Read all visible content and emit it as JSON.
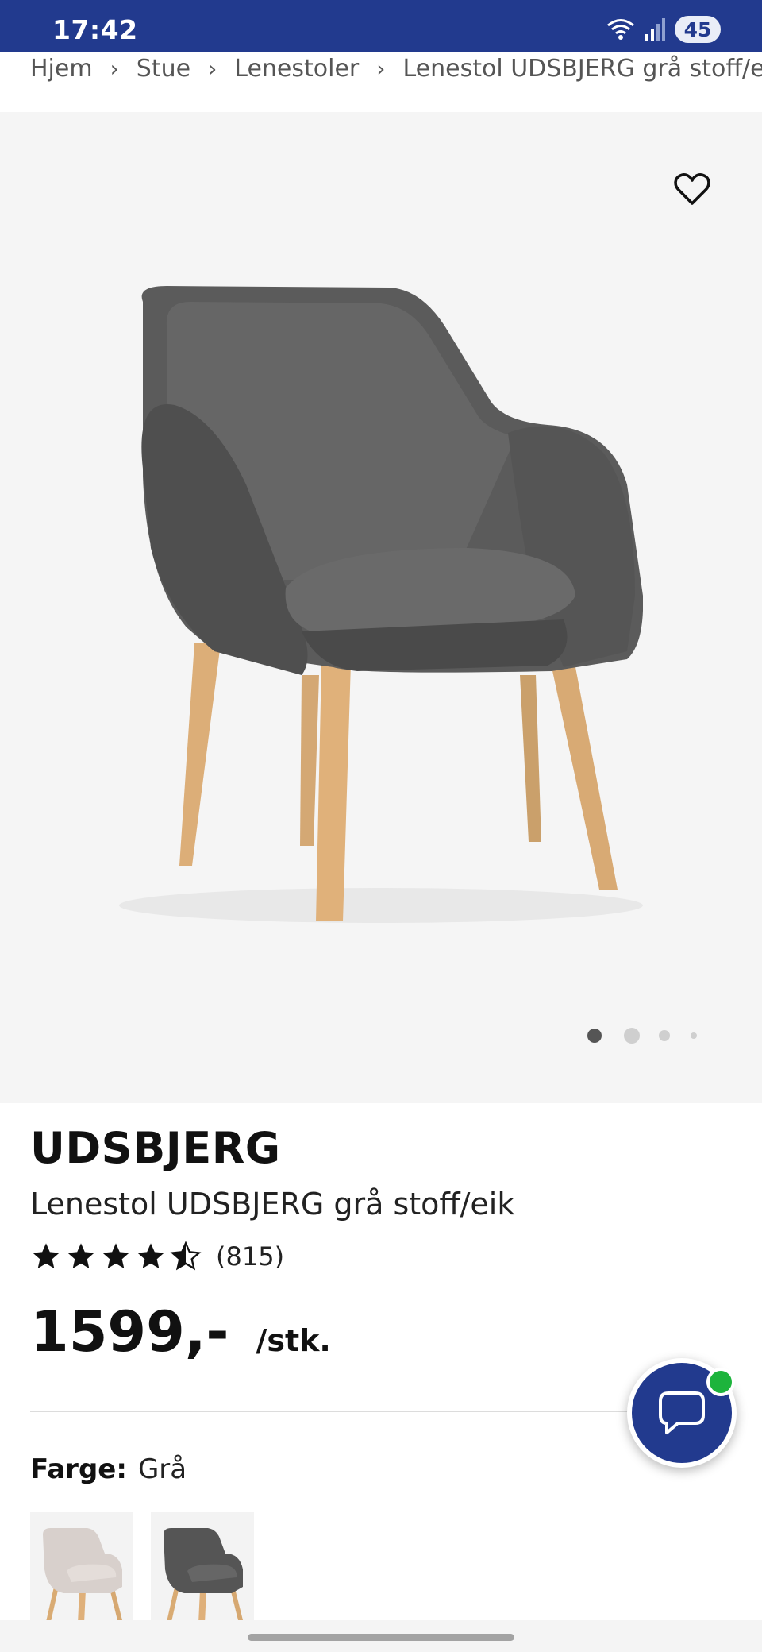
{
  "status_bar": {
    "time": "17:42",
    "battery": "45",
    "icons": [
      "wifi-icon",
      "signal-icon",
      "battery-icon"
    ]
  },
  "breadcrumb": {
    "items": [
      "Hjem",
      "Stue",
      "Lenestoler",
      "Lenestol UDSBJERG grå stoff/eil"
    ]
  },
  "gallery": {
    "current_index": 1,
    "total": 4,
    "favorite_icon": "heart-outline-icon"
  },
  "product": {
    "brand": "UDSBJERG",
    "name": "Lenestol UDSBJERG grå stoff/eik",
    "rating": 4.5,
    "rating_max": 5,
    "rating_count": "(815)",
    "price": "1599,-",
    "unit": "/stk."
  },
  "color": {
    "label": "Farge:",
    "value": "Grå",
    "options": [
      "beige",
      "grå"
    ],
    "selected_index": 1
  },
  "chat": {
    "icon": "chat-bubble-icon",
    "online": true
  },
  "colors": {
    "brand_blue": "#223a8e",
    "online_green": "#1db43c"
  }
}
